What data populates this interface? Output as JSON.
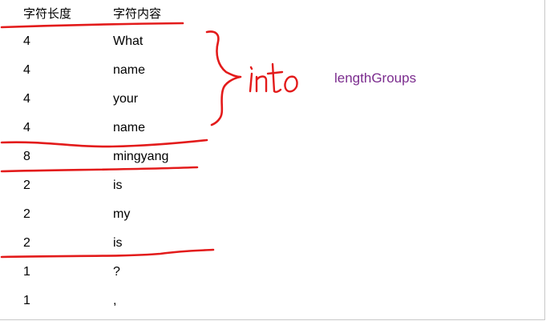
{
  "table": {
    "headers": {
      "length": "字符长度",
      "content": "字符内容"
    },
    "rows": [
      {
        "length": "4",
        "content": "What"
      },
      {
        "length": "4",
        "content": "name"
      },
      {
        "length": "4",
        "content": "your"
      },
      {
        "length": "4",
        "content": "name"
      },
      {
        "length": "8",
        "content": "mingyang"
      },
      {
        "length": "2",
        "content": "is"
      },
      {
        "length": "2",
        "content": "my"
      },
      {
        "length": "2",
        "content": "is"
      },
      {
        "length": "1",
        "content": "?"
      },
      {
        "length": "1",
        "content": ","
      }
    ]
  },
  "annotation": {
    "handwritten": "into",
    "target_label": "lengthGroups"
  },
  "colors": {
    "ink": "#e31b1b",
    "label": "#7b2c8e"
  }
}
